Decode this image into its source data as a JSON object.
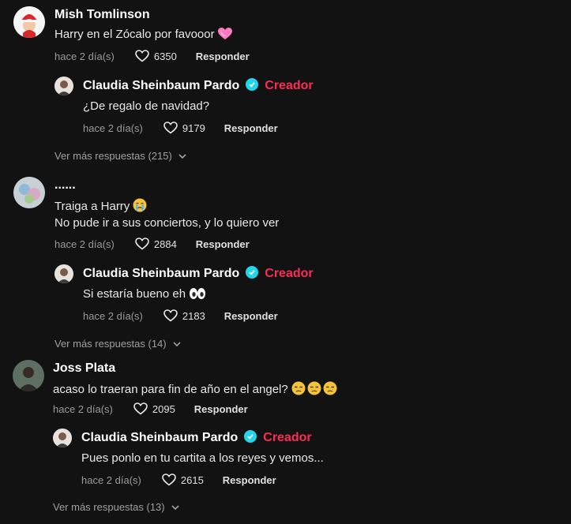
{
  "comments": [
    {
      "author": "Mish Tomlinson",
      "lines": [
        "Harry en el Zócalo por favooor"
      ],
      "time": "hace 2 día(s)",
      "likes": "6350",
      "reply_label": "Responder",
      "emoji": "pink-heart",
      "reply": {
        "author": "Claudia Sheinbaum Pardo",
        "badge": "Creador",
        "text": "¿De regalo de navidad?",
        "time": "hace 2 día(s)",
        "likes": "9179",
        "reply_label": "Responder"
      },
      "more": "Ver más respuestas (215)"
    },
    {
      "author": "......",
      "lines": [
        "Traiga a Harry",
        "No pude ir a sus conciertos, y lo quiero ver"
      ],
      "time": "hace 2 día(s)",
      "likes": "2884",
      "reply_label": "Responder",
      "emoji": "crying-face",
      "reply": {
        "author": "Claudia Sheinbaum Pardo",
        "badge": "Creador",
        "text": "Si estaría bueno eh",
        "time": "hace 2 día(s)",
        "likes": "2183",
        "reply_label": "Responder"
      },
      "more": "Ver más respuestas (14)"
    },
    {
      "author": "Joss Plata",
      "lines": [
        "acaso lo traeran para fin de año en el angel?"
      ],
      "time": "hace 2 día(s)",
      "likes": "2095",
      "reply_label": "Responder",
      "emoji": "unamused-faces",
      "reply": {
        "author": "Claudia Sheinbaum Pardo",
        "badge": "Creador",
        "text": "Pues ponlo en tu cartita a los reyes y vemos...",
        "time": "hace 2 día(s)",
        "likes": "2615",
        "reply_label": "Responder"
      },
      "more": "Ver más respuestas (13)"
    }
  ],
  "colors": {
    "background": "#121212",
    "creator": "#fe2c55",
    "verified": "#20d5ec"
  }
}
